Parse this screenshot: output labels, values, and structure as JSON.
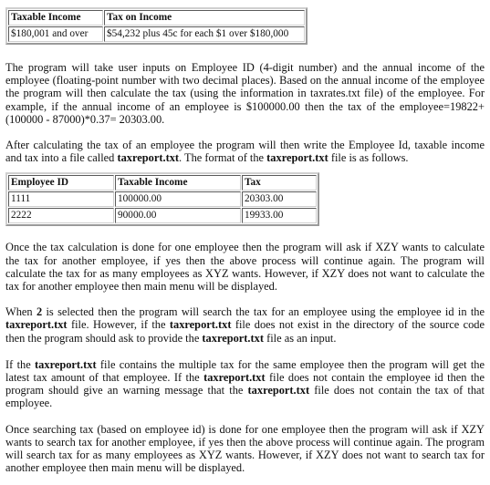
{
  "rates_table": {
    "headers": [
      "Taxable Income",
      "Tax on Income"
    ],
    "rows": [
      [
        "$180,001 and over",
        "$54,232 plus 45c for each $1 over $180,000"
      ]
    ]
  },
  "paragraphs": {
    "p1": "The program will take user inputs on Employee ID (4-digit number) and the annual income of the employee (floating-point number with two decimal places). Based on the annual income of the employee the program will then calculate the tax (using the information in taxrates.txt file) of the employee. For  example, if the annual income of an employee is $100000.00 then the tax of the employee=19822+(100000 - 87000)*0.37= 20303.00.",
    "p2": {
      "a": "After calculating the tax of an employee the program will then write the Employee Id, taxable income and tax into a file called ",
      "b": "taxreport.txt",
      "c": ". The format of the ",
      "d": "taxreport.txt",
      "e": " file is as follows."
    },
    "p3": "Once the tax calculation is done for one employee then the program will ask if XZY wants to calculate the tax for another employee, if yes then the above process will continue again. The program will calculate the tax for as many employees as XYZ wants. However, if XZY does not want to calculate the tax for another employee then main menu will be displayed.",
    "p4": {
      "a": "When ",
      "b": "2",
      "c": " is selected then the program will search the tax for an employee using the employee id in the ",
      "d": "taxreport.txt",
      "e": " file. However, if the ",
      "f": "taxreport.txt",
      "g": " file does not exist in the directory of the source code then the program should ask to provide the ",
      "h": "taxreport.txt",
      "i": " file as an input."
    },
    "p5": {
      "a": "If the ",
      "b": "taxreport.txt",
      "c": " file contains the multiple tax for the same employee then the program will get the latest tax amount of that employee. If the ",
      "d": "taxreport.txt",
      "e": " file does not contain the employee id then the program should give an warning message that the ",
      "f": "taxreport.txt",
      "g": " file does not contain the tax of that employee."
    },
    "p6": "Once searching tax (based on employee id) is done for one employee then the program will ask if XZY wants to search tax for another employee, if yes then the above process will continue again. The program will search tax for as many employees as XYZ wants. However, if XZY does not want to search tax for another employee then main menu will be displayed."
  },
  "report_table": {
    "headers": [
      "Employee ID",
      "Taxable Income",
      "Tax"
    ],
    "rows": [
      [
        "1111",
        "100000.00",
        "20303.00"
      ],
      [
        "2222",
        "90000.00",
        "19933.00"
      ]
    ]
  }
}
